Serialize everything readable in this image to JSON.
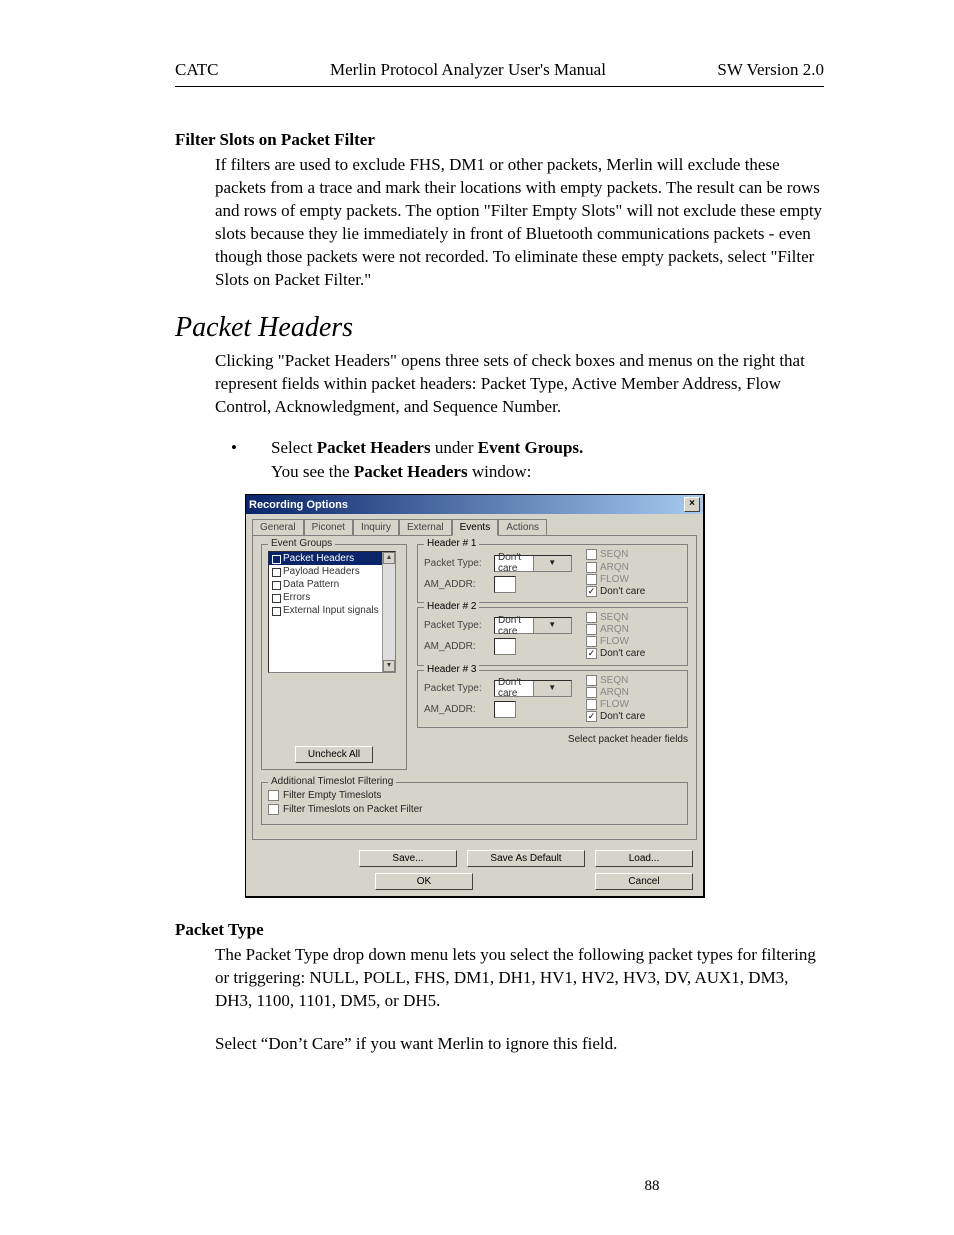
{
  "header": {
    "left": "CATC",
    "center": "Merlin Protocol Analyzer User's Manual",
    "right": "SW Version 2.0"
  },
  "page_number": "88",
  "para1": {
    "heading": "Filter Slots on Packet Filter",
    "body": "If filters are used to exclude FHS, DM1 or other packets, Merlin will exclude these packets from a trace and mark their locations with empty packets.  The result can be rows and rows of empty packets.  The option \"Filter Empty Slots\" will not exclude these empty slots because they lie immediately in front of Bluetooth communications packets - even though those packets were not recorded.  To eliminate these empty packets, select \"Filter Slots on Packet Filter.\""
  },
  "section_title": "Packet Headers",
  "section_intro": "Clicking \"Packet Headers\" opens three sets of check boxes and menus on the right that represent fields within packet headers:  Packet Type, Active Member Address, Flow Control, Acknowledgment, and Sequence Number.",
  "bullet": {
    "prefix": "Select ",
    "bold1": "Packet Headers",
    "mid": " under ",
    "bold2": "Event Groups."
  },
  "sub": {
    "prefix": "You see the ",
    "bold": "Packet Headers",
    "suffix": " window:"
  },
  "dialog": {
    "title": "Recording Options",
    "tabs": [
      "General",
      "Piconet",
      "Inquiry",
      "External",
      "Events",
      "Actions"
    ],
    "active_tab_index": 4,
    "event_groups": {
      "legend": "Event Groups",
      "items": [
        "Packet Headers",
        "Payload Headers",
        "Data Pattern",
        "Errors",
        "External Input signals"
      ],
      "selected_index": 0,
      "uncheck_all": "Uncheck All"
    },
    "headers": [
      {
        "legend": "Header # 1",
        "pkt_label": "Packet Type:",
        "pkt_value": "Don't care",
        "am_label": "AM_ADDR:",
        "flags": [
          "SEQN",
          "ARQN",
          "FLOW",
          "Don't care"
        ],
        "flags_checked": [
          false,
          false,
          false,
          true
        ]
      },
      {
        "legend": "Header # 2",
        "pkt_label": "Packet Type:",
        "pkt_value": "Don't care",
        "am_label": "AM_ADDR:",
        "flags": [
          "SEQN",
          "ARQN",
          "FLOW",
          "Don't care"
        ],
        "flags_checked": [
          false,
          false,
          false,
          true
        ]
      },
      {
        "legend": "Header # 3",
        "pkt_label": "Packet Type:",
        "pkt_value": "Don't care",
        "am_label": "AM_ADDR:",
        "flags": [
          "SEQN",
          "ARQN",
          "FLOW",
          "Don't care"
        ],
        "flags_checked": [
          false,
          false,
          false,
          true
        ]
      }
    ],
    "select_fields_link": "Select packet header fields",
    "additional": {
      "legend": "Additional Timeslot Filtering",
      "cb1": "Filter Empty Timeslots",
      "cb2": "Filter Timeslots on Packet Filter"
    },
    "buttons": {
      "save": "Save...",
      "save_default": "Save As Default",
      "load": "Load...",
      "ok": "OK",
      "cancel": "Cancel"
    }
  },
  "para2": {
    "heading": "Packet Type",
    "body1": "The Packet Type drop down menu lets you select the following packet types for filtering or triggering: NULL, POLL, FHS, DM1, DH1, HV1, HV2, HV3, DV, AUX1, DM3, DH3, 1100, 1101, DM5, or DH5.",
    "body2": "Select “Don’t Care” if you want Merlin to ignore this field."
  }
}
